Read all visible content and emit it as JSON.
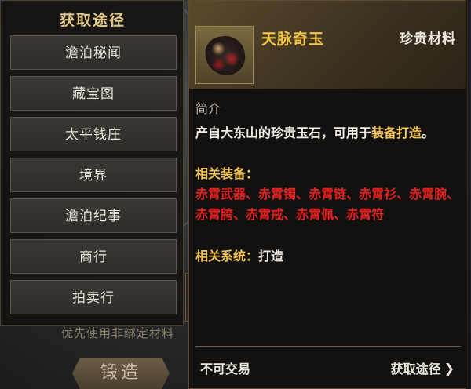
{
  "sources": {
    "title": "获取途径",
    "items": [
      "澹泊秘闻",
      "藏宝图",
      "太平钱庄",
      "境界",
      "澹泊纪事",
      "商行",
      "拍卖行"
    ]
  },
  "background": {
    "hint": "优先使用非绑定材料",
    "forge_label": "锻造"
  },
  "item": {
    "name": "天脉奇玉",
    "category": "珍贵材料",
    "icon": "red-veined-jade-ore-icon",
    "section_label": "简介",
    "desc_prefix": "产自大东山的珍贵玉石，可用于",
    "desc_highlight": "装备打造",
    "desc_suffix": "。",
    "related_equipment_label": "相关装备：",
    "related_equipment": [
      "赤霄武器",
      "赤霄镯",
      "赤霄链",
      "赤霄衫",
      "赤霄腕",
      "赤霄胯",
      "赤霄戒",
      "赤霄佩",
      "赤霄符"
    ],
    "related_system_label": "相关系统：",
    "related_system": "打造",
    "tradable_text": "不可交易",
    "sources_link": "获取途径"
  },
  "colors": {
    "gold": "#f2c455",
    "red": "#e32222",
    "panel_border": "#5c4d32"
  }
}
